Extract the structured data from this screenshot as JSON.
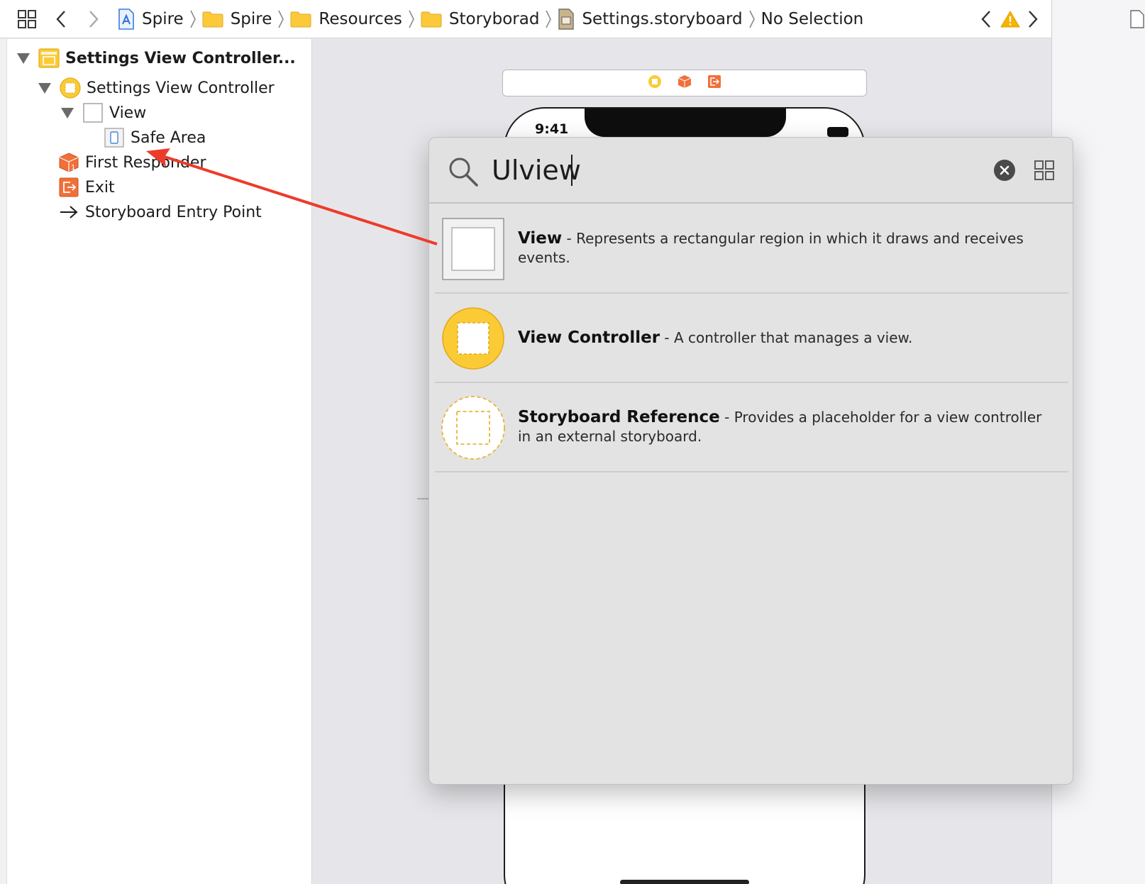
{
  "breadcrumbs": [
    {
      "label": "Spire",
      "icon": "app-icon"
    },
    {
      "label": "Spire",
      "icon": "folder-icon"
    },
    {
      "label": "Resources",
      "icon": "folder-icon"
    },
    {
      "label": "Storyborad",
      "icon": "folder-icon"
    },
    {
      "label": "Settings.storyboard",
      "icon": "storyboard-file-icon"
    },
    {
      "label": "No Selection"
    }
  ],
  "outline": {
    "scene": "Settings View Controller...",
    "controller": "Settings View Controller",
    "view": "View",
    "safe_area": "Safe Area",
    "first_responder": "First Responder",
    "exit": "Exit",
    "entry_point": "Storyboard Entry Point"
  },
  "canvas": {
    "status_time": "9:41"
  },
  "library": {
    "search_value": "Ulview",
    "items": [
      {
        "title": "View",
        "description": " - Represents a rectangular region in which it draws and receives events."
      },
      {
        "title": "View Controller",
        "description": " - A controller that manages a view."
      },
      {
        "title": "Storyboard Reference",
        "description": " - Provides a placeholder for a view controller in an external storyboard."
      }
    ]
  },
  "colors": {
    "accent_yellow": "#fbcb36",
    "accent_orange": "#f0703a",
    "folder_yellow": "#fbc93a",
    "annotation_red": "#ee3b2a"
  }
}
